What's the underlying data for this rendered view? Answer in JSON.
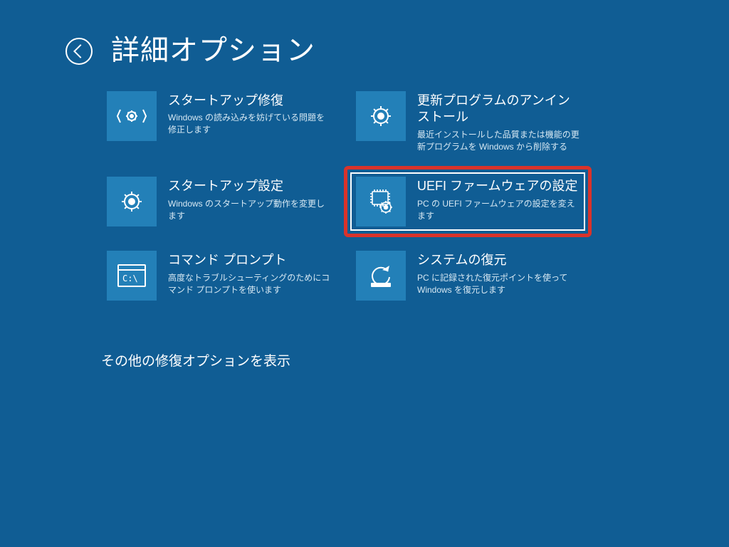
{
  "header": {
    "title": "詳細オプション"
  },
  "tiles": {
    "startup_repair": {
      "title": "スタートアップ修復",
      "desc": "Windows の読み込みを妨げている問題を修正します"
    },
    "uninstall_updates": {
      "title": "更新プログラムのアンインストール",
      "desc": "最近インストールした品質または機能の更新プログラムを Windows から削除する"
    },
    "startup_settings": {
      "title": "スタートアップ設定",
      "desc": "Windows のスタートアップ動作を変更します"
    },
    "uefi": {
      "title": "UEFI ファームウェアの設定",
      "desc": "PC の UEFI ファームウェアの設定を変えます"
    },
    "command_prompt": {
      "title": "コマンド プロンプト",
      "desc": "高度なトラブルシューティングのためにコマンド プロンプトを使います"
    },
    "system_restore": {
      "title": "システムの復元",
      "desc": "PC に記録された復元ポイントを使って Windows を復元します"
    }
  },
  "more_link": "その他の修復オプションを表示"
}
